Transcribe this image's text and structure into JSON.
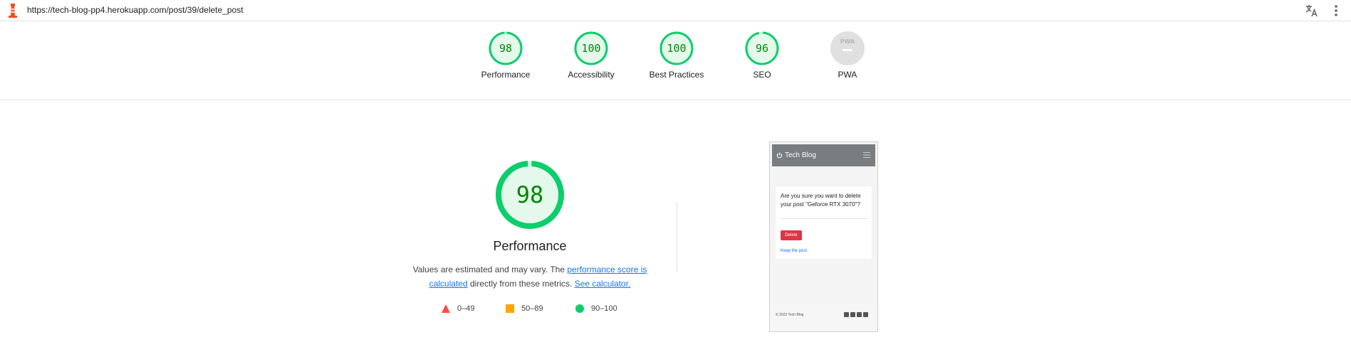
{
  "url_bar": {
    "url": "https://tech-blog-pp4.herokuapp.com/post/39/delete_post"
  },
  "icons": {
    "logo": "lighthouse-icon",
    "translate": "translate-icon",
    "menu": "more-vertical-icon"
  },
  "colors": {
    "pass": "#0cce6b",
    "pass_text": "#008800",
    "pass_fill": "#e5f8ec",
    "average": "#ffa400",
    "fail": "#ff4e42",
    "pwa": "#e0e0e0",
    "link": "#1a73e8"
  },
  "summary": {
    "gauges": [
      {
        "label": "Performance",
        "score": "98",
        "value": 0.98
      },
      {
        "label": "Accessibility",
        "score": "100",
        "value": 1.0
      },
      {
        "label": "Best Practices",
        "score": "100",
        "value": 1.0
      },
      {
        "label": "SEO",
        "score": "96",
        "value": 0.96
      }
    ],
    "pwa": {
      "label": "PWA",
      "badge_text": "PWA"
    }
  },
  "detail": {
    "score": "98",
    "score_value": 0.98,
    "title": "Performance",
    "desc_prefix": "Values are estimated and may vary. The ",
    "desc_link1": "performance score is calculated",
    "desc_middle": " directly from these metrics. ",
    "desc_link2": "See calculator.",
    "legend": [
      {
        "range": "0–49",
        "shape": "triangle"
      },
      {
        "range": "50–89",
        "shape": "square"
      },
      {
        "range": "90–100",
        "shape": "circle"
      }
    ]
  },
  "thumbnail": {
    "brand": "Tech Blog",
    "question": "Are you sure you want to delete your post \"Geforce RTX 3070\"?",
    "delete_label": "Delete",
    "keep_label": "Keep the post",
    "footer_copy": "© 2022 Tech Blog"
  }
}
